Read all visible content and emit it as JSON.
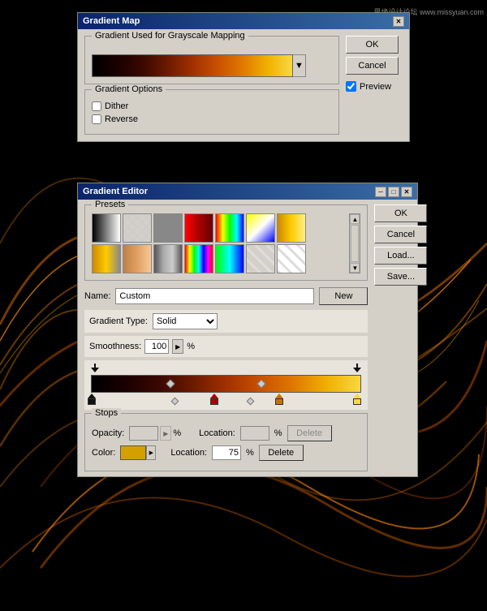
{
  "background": {
    "color": "#000000"
  },
  "watermark": {
    "left": "思缘设计论坛",
    "right": "www.missyuan.com"
  },
  "gradient_map_window": {
    "title": "Gradient Map",
    "group_gradient": "Gradient Used for Grayscale Mapping",
    "group_options": "Gradient Options",
    "dither_label": "Dither",
    "reverse_label": "Reverse",
    "ok_label": "OK",
    "cancel_label": "Cancel",
    "preview_label": "Preview",
    "preview_checked": true
  },
  "gradient_editor_window": {
    "title": "Gradient Editor",
    "presets_label": "Presets",
    "ok_label": "OK",
    "cancel_label": "Cancel",
    "load_label": "Load...",
    "save_label": "Save...",
    "name_label": "Name:",
    "name_value": "Custom",
    "new_label": "New",
    "type_label": "Gradient Type:",
    "type_value": "Solid",
    "smoothness_label": "Smoothness:",
    "smoothness_value": "100",
    "smoothness_unit": "%",
    "stops_label": "Stops",
    "opacity_label": "Opacity:",
    "opacity_location_label": "Location:",
    "opacity_pct": "%",
    "opacity_delete_label": "Delete",
    "color_label": "Color:",
    "color_location_label": "Location:",
    "color_location_value": "75",
    "color_pct": "%",
    "color_delete_label": "Delete"
  }
}
